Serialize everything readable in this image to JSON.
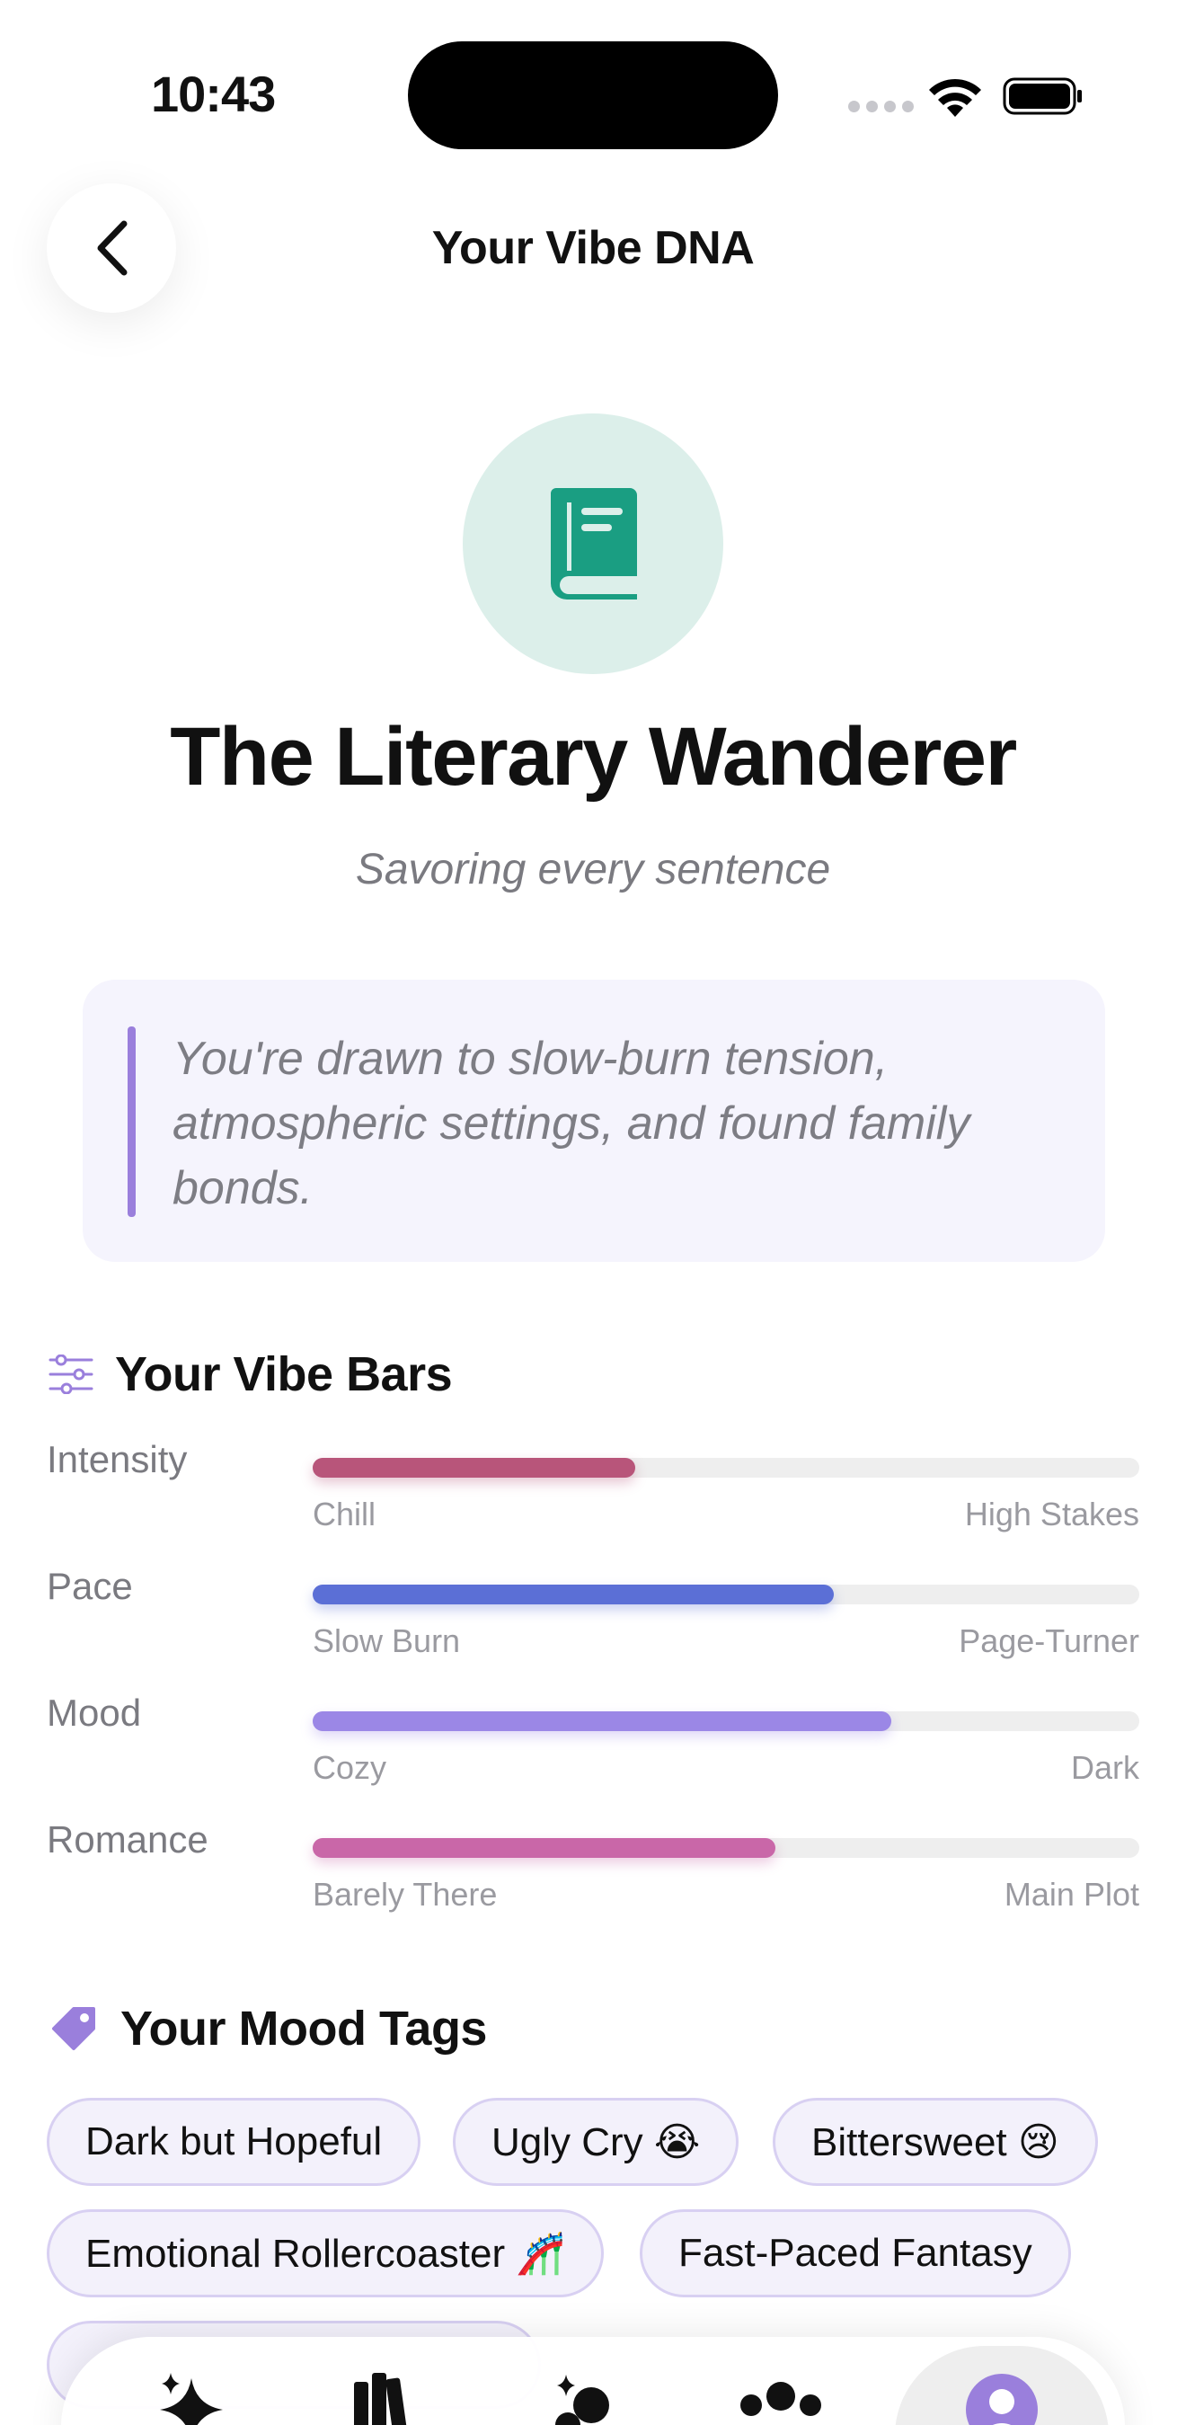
{
  "status_bar": {
    "time": "10:43"
  },
  "header": {
    "title": "Your Vibe DNA"
  },
  "persona": {
    "icon": "book-icon",
    "title": "The Literary Wanderer",
    "subtitle": "Savoring every sentence",
    "quote": "You're drawn to slow-burn tension, atmospheric settings, and found family bonds."
  },
  "colors": {
    "accent": "#9a7fdc",
    "icon_green": "#1a9e82",
    "icon_bg": "#dcefea"
  },
  "vibe_bars": {
    "title": "Your Vibe Bars",
    "items": [
      {
        "name": "Intensity",
        "left": "Chill",
        "right": "High Stakes",
        "value": 0.39,
        "color": "#b8557a"
      },
      {
        "name": "Pace",
        "left": "Slow Burn",
        "right": "Page-Turner",
        "value": 0.63,
        "color": "#5b6fd6"
      },
      {
        "name": "Mood",
        "left": "Cozy",
        "right": "Dark",
        "value": 0.7,
        "color": "#9b87e6"
      },
      {
        "name": "Romance",
        "left": "Barely There",
        "right": "Main Plot",
        "value": 0.56,
        "color": "#c967a8"
      }
    ]
  },
  "mood_tags": {
    "title": "Your Mood Tags",
    "tags": [
      "Dark but Hopeful",
      "Ugly Cry 😭",
      "Bittersweet 😢",
      "Emotional Rollercoaster 🎢",
      "Fast-Paced Fantasy"
    ]
  },
  "tabbar": {
    "tabs": [
      "sparkles-icon",
      "books-icon",
      "bubbles-icon",
      "people-icon",
      "profile-icon"
    ],
    "active": 4
  }
}
